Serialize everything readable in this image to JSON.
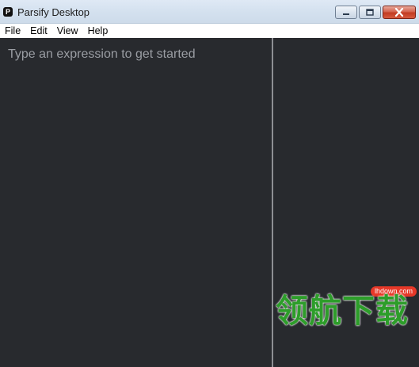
{
  "window": {
    "title": "Parsify Desktop",
    "icon_letter": "P",
    "controls": [
      "minimize",
      "maximize",
      "close"
    ]
  },
  "menubar": {
    "items": [
      {
        "label": "File"
      },
      {
        "label": "Edit"
      },
      {
        "label": "View"
      },
      {
        "label": "Help"
      }
    ]
  },
  "editor": {
    "placeholder": "Type an expression to get started"
  },
  "watermark": {
    "url": "lhdown.com",
    "text": "领航下载"
  },
  "colors": {
    "background": "#282a2e",
    "divider": "#8d8f93",
    "placeholder": "#9a9da3",
    "watermark_green": "#2d9d2a",
    "watermark_red": "#e73828"
  }
}
